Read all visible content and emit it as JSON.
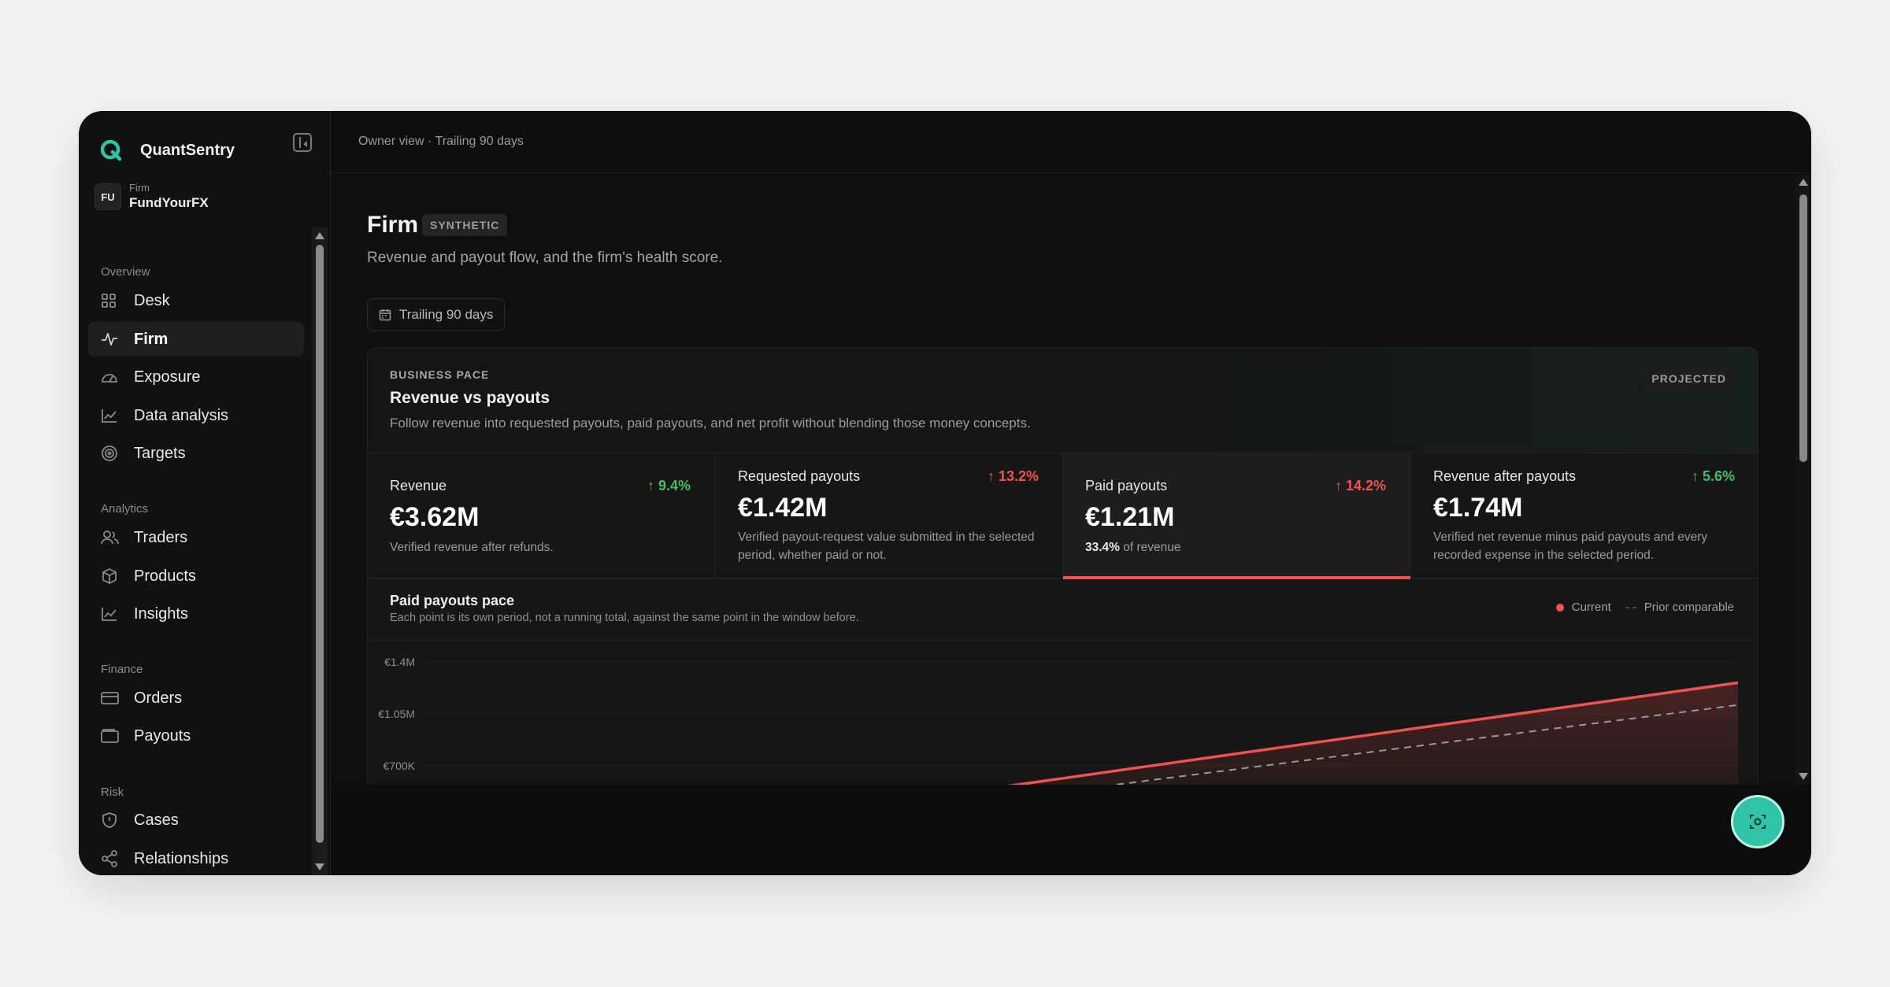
{
  "app": {
    "name": "QuantSentry",
    "logo_color": "#2fc4a5"
  },
  "firm": {
    "avatar": "FU",
    "kicker": "Firm",
    "name": "FundYourFX"
  },
  "nav": {
    "overview": {
      "label": "Overview",
      "items": [
        {
          "label": "Desk",
          "icon": "grid-icon"
        },
        {
          "label": "Firm",
          "icon": "pulse-icon",
          "active": true
        },
        {
          "label": "Exposure",
          "icon": "gauge-icon"
        },
        {
          "label": "Data analysis",
          "icon": "line-chart-icon"
        },
        {
          "label": "Targets",
          "icon": "target-icon"
        }
      ]
    },
    "analytics": {
      "label": "Analytics",
      "items": [
        {
          "label": "Traders",
          "icon": "users-icon"
        },
        {
          "label": "Products",
          "icon": "package-icon"
        },
        {
          "label": "Insights",
          "icon": "line-chart-icon"
        }
      ]
    },
    "finance": {
      "label": "Finance",
      "items": [
        {
          "label": "Orders",
          "icon": "credit-card-icon"
        },
        {
          "label": "Payouts",
          "icon": "wallet-icon"
        }
      ]
    },
    "risk": {
      "label": "Risk",
      "items": [
        {
          "label": "Cases",
          "icon": "shield-icon"
        },
        {
          "label": "Relationships",
          "icon": "share-icon"
        }
      ]
    }
  },
  "topbar": {
    "context": "Owner view · Trailing 90 days"
  },
  "page": {
    "title": "Firm",
    "badge": "SYNTHETIC",
    "subtitle": "Revenue and payout flow, and the firm's health score.",
    "range_button": "Trailing 90 days"
  },
  "card": {
    "kicker": "BUSINESS PACE",
    "title": "Revenue vs payouts",
    "description": "Follow revenue into requested payouts, paid payouts, and net profit without blending those money concepts.",
    "badge": "PROJECTED",
    "metrics": [
      {
        "label": "Revenue",
        "delta": "9.4%",
        "delta_color": "#3fbf6a",
        "value": "€3.62M",
        "note": "Verified revenue after refunds."
      },
      {
        "label": "Requested payouts",
        "delta": "13.2%",
        "delta_color": "#ef5350",
        "value": "€1.42M",
        "note": "Verified payout-request value submitted in the selected period, whether paid or not."
      },
      {
        "label": "Paid payouts",
        "delta": "14.2%",
        "delta_color": "#ef5350",
        "value": "€1.21M",
        "note_strong": "33.4%",
        "note": "of revenue",
        "selected": true
      },
      {
        "label": "Revenue after payouts",
        "delta": "5.6%",
        "delta_color": "#3fbf6a",
        "value": "€1.74M",
        "note": "Verified net revenue minus paid payouts and every recorded expense in the selected period."
      }
    ]
  },
  "chart": {
    "title": "Paid payouts pace",
    "subtitle": "Each point is its own period, not a running total, against the same point in the window before.",
    "legend": {
      "current": "Current",
      "prior": "Prior comparable"
    }
  },
  "chart_data": {
    "type": "line",
    "ylim": [
      0,
      1400000
    ],
    "y_ticks": [
      {
        "value": 1400000,
        "label": "€1.4M"
      },
      {
        "value": 1050000,
        "label": "€1.05M"
      },
      {
        "value": 700000,
        "label": "€700K"
      }
    ],
    "x": [
      0,
      1
    ],
    "series": [
      {
        "name": "Current",
        "color": "#ef5350",
        "dashed": false,
        "points": [
          [
            0.41,
            520000
          ],
          [
            1.0,
            1260000
          ]
        ]
      },
      {
        "name": "Prior comparable",
        "color": "#9a9a9a",
        "dashed": true,
        "points": [
          [
            0.48,
            520000
          ],
          [
            1.0,
            1110000
          ]
        ]
      }
    ]
  }
}
